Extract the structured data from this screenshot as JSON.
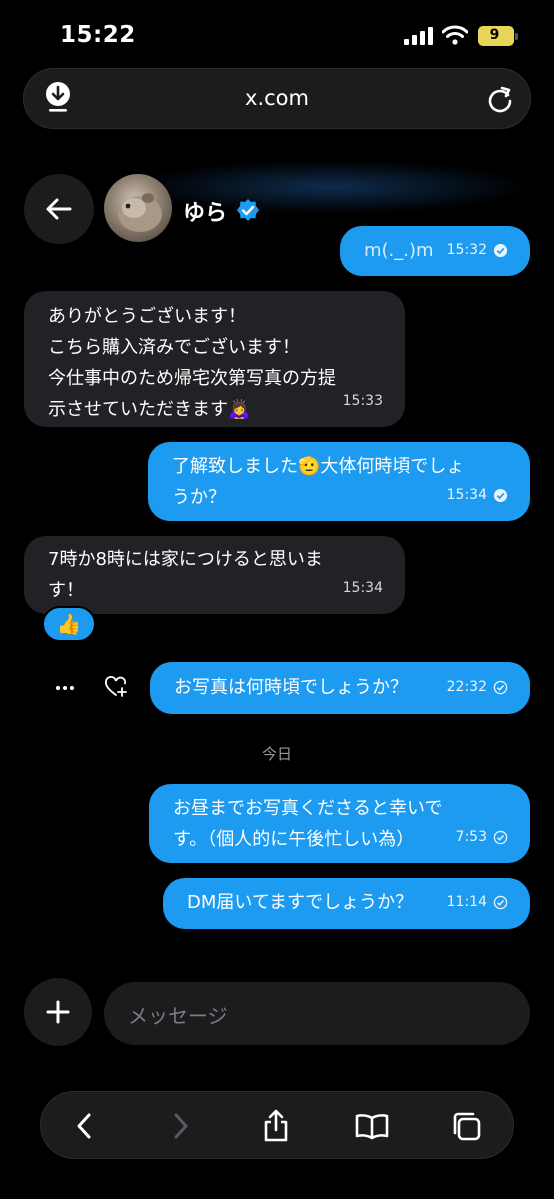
{
  "status_bar": {
    "time": "15:22",
    "battery": "9"
  },
  "browser": {
    "url": "x.com"
  },
  "chat": {
    "contact_name": "ゆら"
  },
  "messages": [
    {
      "text": "m(._.)m",
      "time": "15:32"
    },
    {
      "text": "ありがとうございます！\nこちら購入済みでございます！\n今仕事中のため帰宅次第写真の方提\n示させていただきます🙇‍♀️",
      "time": "15:33"
    },
    {
      "text": "了解致しました🫡大体何時頃でしょ\nうか？",
      "time": "15:34"
    },
    {
      "text": "7時か8時には家につけると思いま\nす！",
      "time": "15:34",
      "reaction": "👍"
    },
    {
      "text": "お写真は何時頃でしょうか？",
      "time": "22:32"
    },
    {
      "text": "お昼までお写真くださると幸いで\nす。（個人的に午後忙しい為）",
      "time": "7:53"
    },
    {
      "text": "DM届いてますでしょうか？",
      "time": "11:14"
    }
  ],
  "day_separator": "今日",
  "composer": {
    "placeholder": "メッセージ"
  },
  "colors": {
    "accent": "#1d9bf0",
    "incoming_bubble": "#222226",
    "background": "#000000"
  },
  "icons": [
    "download-icon",
    "reload-icon",
    "back-arrow-icon",
    "verified-badge-icon",
    "check-icon",
    "more-icon",
    "heart-plus-icon",
    "plus-icon",
    "browser-back-icon",
    "browser-forward-icon",
    "share-icon",
    "bookmarks-icon",
    "tabs-icon"
  ]
}
